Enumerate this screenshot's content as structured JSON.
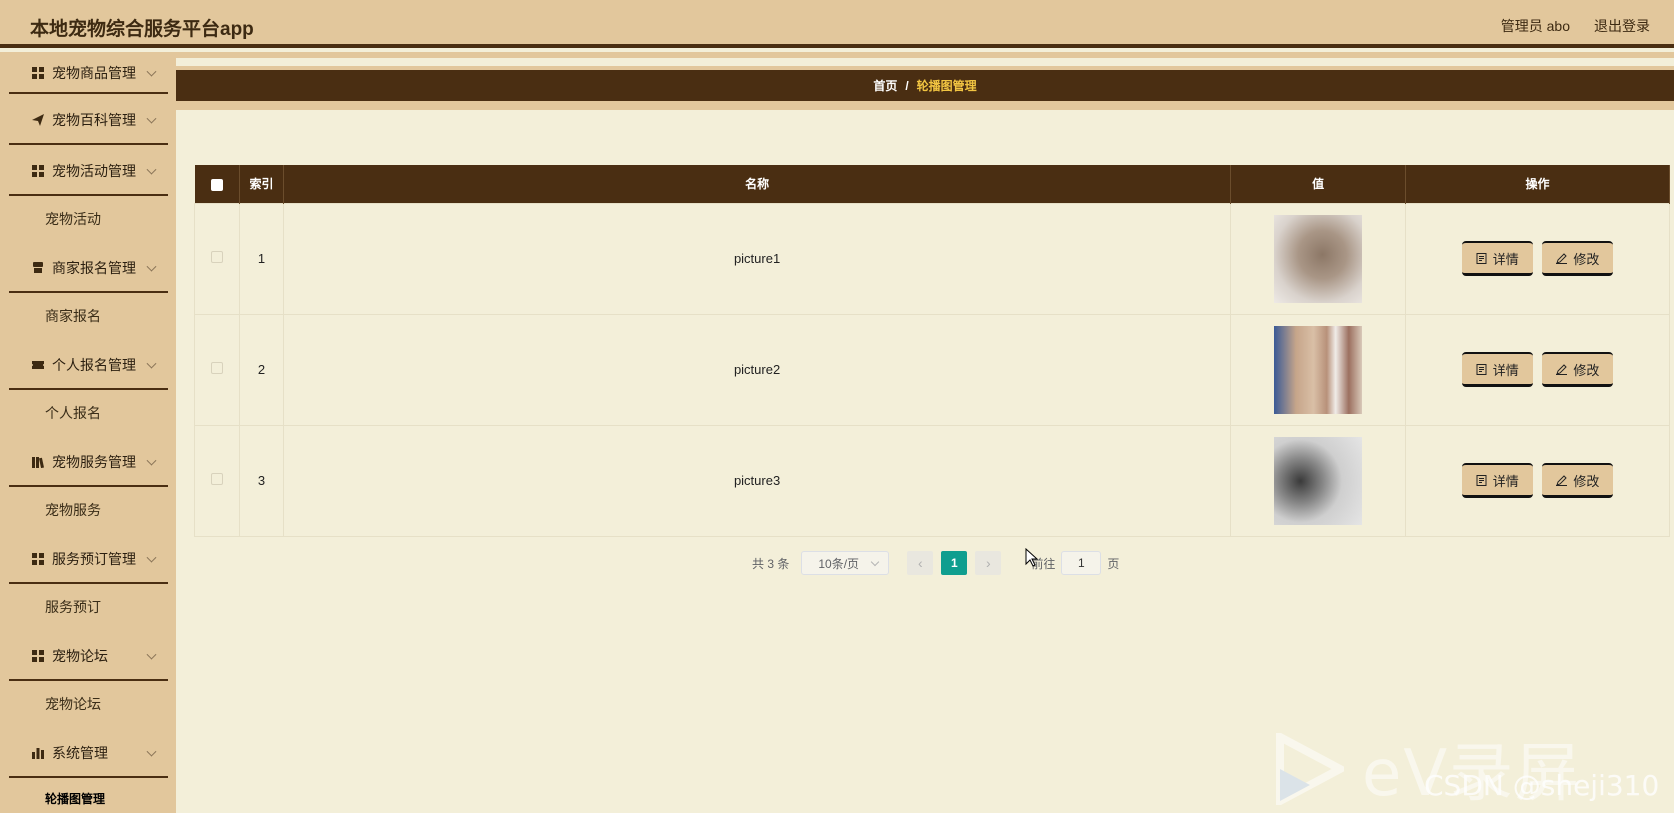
{
  "header": {
    "app_title": "本地宠物综合服务平台app",
    "user_label": "管理员 abo",
    "logout_label": "退出登录"
  },
  "sidebar": {
    "items": [
      {
        "label": "宠物商品管理",
        "icon": "grid-icon"
      },
      {
        "label": "宠物百科管理",
        "icon": "send-icon"
      },
      {
        "label": "宠物活动管理",
        "icon": "grid-icon",
        "sub": "宠物活动"
      },
      {
        "label": "商家报名管理",
        "icon": "shop-icon",
        "sub": "商家报名"
      },
      {
        "label": "个人报名管理",
        "icon": "ticket-icon",
        "sub": "个人报名"
      },
      {
        "label": "宠物服务管理",
        "icon": "books-icon",
        "sub": "宠物服务"
      },
      {
        "label": "服务预订管理",
        "icon": "grid-icon",
        "sub": "服务预订"
      },
      {
        "label": "宠物论坛",
        "icon": "grid-icon",
        "sub": "宠物论坛"
      },
      {
        "label": "系统管理",
        "icon": "bar-chart-icon",
        "sub": "轮播图管理"
      }
    ]
  },
  "breadcrumb": {
    "home": "首页",
    "separator": "/",
    "current": "轮播图管理"
  },
  "table": {
    "columns": [
      "索引",
      "名称",
      "值",
      "操作"
    ],
    "rows": [
      {
        "index": "1",
        "name": "picture1",
        "image": "cat-photo"
      },
      {
        "index": "2",
        "name": "picture2",
        "image": "paw-photo"
      },
      {
        "index": "3",
        "name": "picture3",
        "image": "grayscale-photo"
      }
    ],
    "detail_label": "详情",
    "edit_label": "修改"
  },
  "pagination": {
    "total": "共 3 条",
    "page_size": "10条/页",
    "current_page": "1",
    "goto_label": "前往",
    "goto_value": "1",
    "page_suffix": "页",
    "prev": "‹",
    "next": "›"
  },
  "watermark": {
    "ev": "eV录屏",
    "csdn": "CSDN @sheji310"
  },
  "colors": {
    "header_bg": "#e2c79c",
    "dark_brown": "#4a2e12",
    "page_bg": "#f3efd9",
    "accent_gold": "#f2c542",
    "pager_active": "#0f9e8f"
  }
}
